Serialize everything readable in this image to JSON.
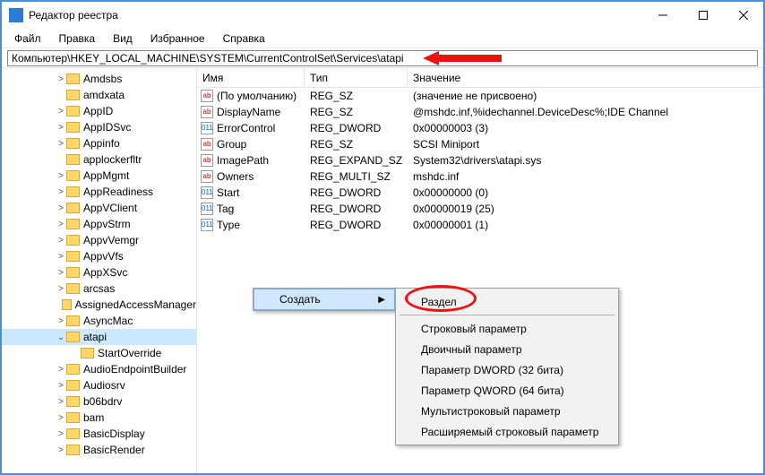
{
  "window": {
    "title": "Редактор реестра",
    "address": "Компьютер\\HKEY_LOCAL_MACHINE\\SYSTEM\\CurrentControlSet\\Services\\atapi"
  },
  "menu": {
    "items": [
      "Файл",
      "Правка",
      "Вид",
      "Избранное",
      "Справка"
    ]
  },
  "tree": {
    "items": [
      {
        "label": "Amdsbs",
        "indent": 60,
        "exp": ">"
      },
      {
        "label": "amdxata",
        "indent": 60,
        "exp": ""
      },
      {
        "label": "AppID",
        "indent": 60,
        "exp": ">"
      },
      {
        "label": "AppIDSvc",
        "indent": 60,
        "exp": ">"
      },
      {
        "label": "Appinfo",
        "indent": 60,
        "exp": ">"
      },
      {
        "label": "applockerfltr",
        "indent": 60,
        "exp": ""
      },
      {
        "label": "AppMgmt",
        "indent": 60,
        "exp": ">"
      },
      {
        "label": "AppReadiness",
        "indent": 60,
        "exp": ">"
      },
      {
        "label": "AppVClient",
        "indent": 60,
        "exp": ">"
      },
      {
        "label": "AppvStrm",
        "indent": 60,
        "exp": ">"
      },
      {
        "label": "AppvVemgr",
        "indent": 60,
        "exp": ">"
      },
      {
        "label": "AppvVfs",
        "indent": 60,
        "exp": ">"
      },
      {
        "label": "AppXSvc",
        "indent": 60,
        "exp": ">"
      },
      {
        "label": "arcsas",
        "indent": 60,
        "exp": ">"
      },
      {
        "label": "AssignedAccessManager",
        "indent": 60,
        "exp": ""
      },
      {
        "label": "AsyncMac",
        "indent": 60,
        "exp": ">"
      },
      {
        "label": "atapi",
        "indent": 60,
        "exp": "v",
        "selected": true
      },
      {
        "label": "StartOverride",
        "indent": 76,
        "exp": ""
      },
      {
        "label": "AudioEndpointBuilder",
        "indent": 60,
        "exp": ">"
      },
      {
        "label": "Audiosrv",
        "indent": 60,
        "exp": ">"
      },
      {
        "label": "b06bdrv",
        "indent": 60,
        "exp": ">"
      },
      {
        "label": "bam",
        "indent": 60,
        "exp": ">"
      },
      {
        "label": "BasicDisplay",
        "indent": 60,
        "exp": ">"
      },
      {
        "label": "BasicRender",
        "indent": 60,
        "exp": ">"
      }
    ]
  },
  "listhead": {
    "name": "Имя",
    "type": "Тип",
    "value": "Значение"
  },
  "rows": [
    {
      "icon": "sz",
      "name": "(По умолчанию)",
      "type": "REG_SZ",
      "value": "(значение не присвоено)"
    },
    {
      "icon": "sz",
      "name": "DisplayName",
      "type": "REG_SZ",
      "value": "@mshdc.inf,%idechannel.DeviceDesc%;IDE Channel"
    },
    {
      "icon": "dw",
      "name": "ErrorControl",
      "type": "REG_DWORD",
      "value": "0x00000003 (3)"
    },
    {
      "icon": "sz",
      "name": "Group",
      "type": "REG_SZ",
      "value": "SCSI Miniport"
    },
    {
      "icon": "sz",
      "name": "ImagePath",
      "type": "REG_EXPAND_SZ",
      "value": "System32\\drivers\\atapi.sys"
    },
    {
      "icon": "sz",
      "name": "Owners",
      "type": "REG_MULTI_SZ",
      "value": "mshdc.inf"
    },
    {
      "icon": "dw",
      "name": "Start",
      "type": "REG_DWORD",
      "value": "0x00000000 (0)"
    },
    {
      "icon": "dw",
      "name": "Tag",
      "type": "REG_DWORD",
      "value": "0x00000019 (25)"
    },
    {
      "icon": "dw",
      "name": "Type",
      "type": "REG_DWORD",
      "value": "0x00000001 (1)"
    }
  ],
  "context1": {
    "create": "Создать"
  },
  "context2": {
    "items": [
      "Раздел",
      "Строковый параметр",
      "Двоичный параметр",
      "Параметр DWORD (32 бита)",
      "Параметр QWORD (64 бита)",
      "Мультистроковый параметр",
      "Расширяемый строковый параметр"
    ]
  }
}
